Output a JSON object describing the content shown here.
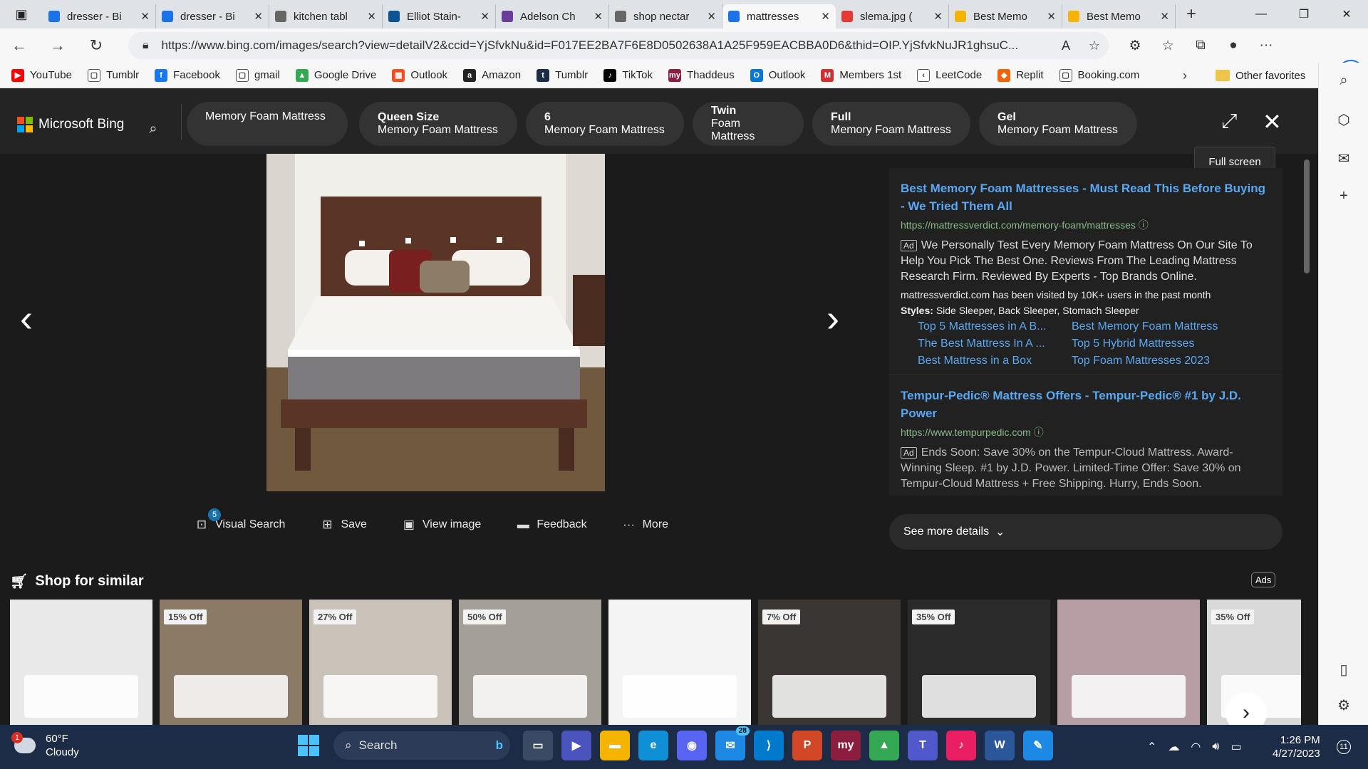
{
  "browser": {
    "tabs": [
      {
        "label": "dresser - Bi",
        "color": "#1a73e8"
      },
      {
        "label": "dresser - Bi",
        "color": "#1a73e8"
      },
      {
        "label": "kitchen tabl",
        "color": "#666666"
      },
      {
        "label": "Elliot Stain-",
        "color": "#0b5394"
      },
      {
        "label": "Adelson Ch",
        "color": "#6a3d9a"
      },
      {
        "label": "shop nectar",
        "color": "#666666"
      },
      {
        "label": "mattresses",
        "color": "#1a73e8"
      },
      {
        "label": "slema.jpg (",
        "color": "#e53935"
      },
      {
        "label": "Best Memo",
        "color": "#f4b400"
      },
      {
        "label": "Best Memo",
        "color": "#f4b400"
      }
    ],
    "url": "https://www.bing.com/images/search?view=detailV2&ccid=YjSfvkNu&id=F017EE2BA7F6E8D0502638A1A25F959EACBBA0D6&thid=OIP.YjSfvkNuJR1ghsuC...",
    "favorites": [
      {
        "label": "YouTube",
        "color": "#ff0000",
        "glyph": "▶"
      },
      {
        "label": "Tumblr",
        "color": "#ffffff",
        "glyph": "▢"
      },
      {
        "label": "Facebook",
        "color": "#1877f2",
        "glyph": "f"
      },
      {
        "label": "gmail",
        "color": "#ffffff",
        "glyph": "▢"
      },
      {
        "label": "Google Drive",
        "color": "#34a853",
        "glyph": "▲"
      },
      {
        "label": "Outlook",
        "color": "#f25022",
        "glyph": "▦"
      },
      {
        "label": "Amazon",
        "color": "#222222",
        "glyph": "a"
      },
      {
        "label": "Tumblr",
        "color": "#1d2c46",
        "glyph": "t"
      },
      {
        "label": "TikTok",
        "color": "#000000",
        "glyph": "♪"
      },
      {
        "label": "Thaddeus",
        "color": "#8b1e3f",
        "glyph": "my"
      },
      {
        "label": "Outlook",
        "color": "#0078d4",
        "glyph": "O"
      },
      {
        "label": "Members 1st",
        "color": "#d32f2f",
        "glyph": "M"
      },
      {
        "label": "LeetCode",
        "color": "#ffffff",
        "glyph": "‹"
      },
      {
        "label": "Replit",
        "color": "#f26207",
        "glyph": "◆"
      },
      {
        "label": "Booking.com",
        "color": "#ffffff",
        "glyph": "▢"
      }
    ],
    "other_favorites": "Other favorites"
  },
  "bing": {
    "logo": "Microsoft Bing",
    "pills": [
      {
        "line1": "Memory Foam Mattress",
        "line2": ""
      },
      {
        "line1": "Queen Size",
        "line2": "Memory Foam Mattress"
      },
      {
        "line1": "6",
        "line2": "Memory Foam Mattress"
      },
      {
        "line1": "Twin",
        "line2": "Foam Mattress"
      },
      {
        "line1": "Full",
        "line2": "Memory Foam Mattress"
      },
      {
        "line1": "Gel",
        "line2": "Memory Foam Mattress"
      }
    ],
    "tooltip": "Full screen",
    "actions": [
      {
        "label": "Visual Search",
        "icon": "visual-search-icon",
        "glyph": "⊡"
      },
      {
        "label": "Save",
        "icon": "save-icon",
        "glyph": "⊞"
      },
      {
        "label": "View image",
        "icon": "view-image-icon",
        "glyph": "▣"
      },
      {
        "label": "Feedback",
        "icon": "feedback-icon",
        "glyph": "▬"
      },
      {
        "label": "More",
        "icon": "more-icon",
        "glyph": "···"
      }
    ],
    "visual_search_badge": "5",
    "ads": [
      {
        "title": "Best Memory Foam Mattresses - Must Read This Before Buying - We Tried Them All",
        "url": "https://mattressverdict.com/memory-foam/mattresses",
        "tag": "Ad",
        "text": "We Personally Test Every Memory Foam Mattress On Our Site To Help You Pick The Best One. Reviews From The Leading Mattress Research Firm. Reviewed By Experts - Top Brands Online.",
        "visited": "mattressverdict.com has been visited by 10K+ users in the past month",
        "styles_label": "Styles:",
        "styles": "Side Sleeper, Back Sleeper, Stomach Sleeper",
        "sitelinks": [
          "Top 5 Mattresses in A B...",
          "Best Memory Foam Mattress",
          "The Best Mattress In A ...",
          "Top 5 Hybrid Mattresses",
          "Best Mattress in a Box",
          "Top Foam Mattresses 2023"
        ]
      },
      {
        "title": "Tempur-Pedic® Mattress Offers - Tempur-Pedic® #1 by J.D. Power",
        "url": "https://www.tempurpedic.com",
        "tag": "Ad",
        "text": "Ends Soon: Save 30% on the Tempur-Cloud Mattress. Award-Winning Sleep. #1 by J.D. Power. Limited-Time Offer: Save 30% on Tempur-Cloud Mattress + Free Shipping. Hurry, Ends Soon."
      }
    ],
    "see_more": "See more details",
    "shop_title": "Shop for similar",
    "ads_label": "Ads",
    "products": [
      {
        "discount": "",
        "bg": "#e9e9e9"
      },
      {
        "discount": "15% Off",
        "bg": "#8a7a66"
      },
      {
        "discount": "27% Off",
        "bg": "#c9c2b8"
      },
      {
        "discount": "50% Off",
        "bg": "#a59f99"
      },
      {
        "discount": "",
        "bg": "#f4f4f4"
      },
      {
        "discount": "7% Off",
        "bg": "#3a3633"
      },
      {
        "discount": "35% Off",
        "bg": "#2a2a2a"
      },
      {
        "discount": "",
        "bg": "#b79ea5"
      },
      {
        "discount": "35% Off",
        "bg": "#d9d9d9"
      }
    ]
  },
  "taskbar": {
    "temp": "60°F",
    "condition": "Cloudy",
    "weather_badge": "1",
    "search": "Search",
    "apps": [
      {
        "name": "task-view",
        "color": "#3b4a63",
        "glyph": "▭"
      },
      {
        "name": "teams-meet",
        "color": "#4b53bc",
        "glyph": "▶"
      },
      {
        "name": "file-explorer",
        "color": "#f4b400",
        "glyph": "▬"
      },
      {
        "name": "edge",
        "color": "#0f8fd6",
        "glyph": "e"
      },
      {
        "name": "discord",
        "color": "#5865f2",
        "glyph": "◉"
      },
      {
        "name": "mail",
        "color": "#1e88e5",
        "glyph": "✉"
      },
      {
        "name": "vscode",
        "color": "#007acc",
        "glyph": "⟩"
      },
      {
        "name": "powerpoint",
        "color": "#d24726",
        "glyph": "P"
      },
      {
        "name": "my-app",
        "color": "#8b1e3f",
        "glyph": "my"
      },
      {
        "name": "google-drive",
        "color": "#34a853",
        "glyph": "▲"
      },
      {
        "name": "teams",
        "color": "#5059c9",
        "glyph": "T"
      },
      {
        "name": "music",
        "color": "#e91e63",
        "glyph": "♪"
      },
      {
        "name": "word",
        "color": "#2b579a",
        "glyph": "W"
      },
      {
        "name": "paint",
        "color": "#1e88e5",
        "glyph": "✎"
      }
    ],
    "mail_badge": "28",
    "time": "1:26 PM",
    "date": "4/27/2023",
    "notifications": "11"
  }
}
